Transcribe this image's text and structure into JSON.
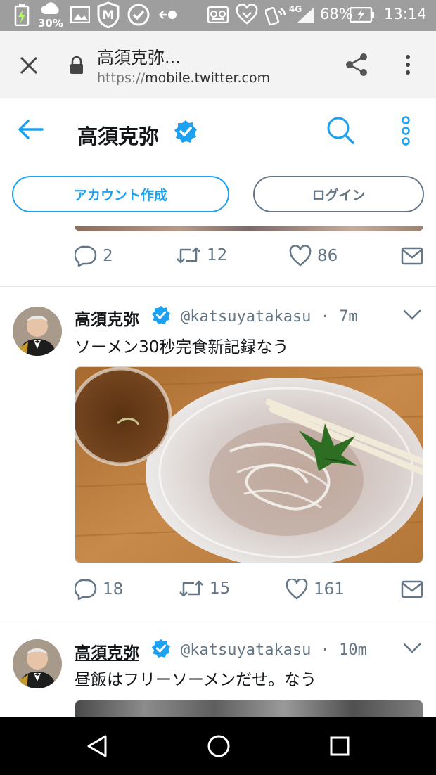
{
  "status_bar": {
    "battery_saver_percent": "30%",
    "battery_percent": "68%",
    "network": "4G",
    "time": "13:14",
    "icons": [
      "charging-icon",
      "cloud-icon",
      "image-icon",
      "mcafee-shield-icon",
      "check-circle-icon",
      "link-icon",
      "voicemail-icon",
      "heart-hand-icon",
      "nfc-icon",
      "signal-icon",
      "battery-icon"
    ]
  },
  "browser": {
    "page_title": "高須克弥...",
    "url_scheme": "https://",
    "url_host": "mobile.twitter.com",
    "icons": [
      "close-icon",
      "lock-icon",
      "share-icon",
      "more-vert-icon"
    ]
  },
  "profile_header": {
    "name": "高須克弥",
    "verified": true,
    "signup_label": "アカウント作成",
    "login_label": "ログイン",
    "accent_color": "#1da1f2"
  },
  "tweets": [
    {
      "partial": true,
      "replies": "2",
      "retweets": "12",
      "likes": "86"
    },
    {
      "name": "高須克弥",
      "handle": "@katsuyatakasu",
      "time": "· 7m",
      "text": "ソーメン30秒完食新記録なう",
      "replies": "18",
      "retweets": "15",
      "likes": "161"
    },
    {
      "name": "高須克弥",
      "handle": "@katsuyatakasu",
      "time": "· 10m",
      "text": "昼飯はフリーソーメンだせ。なう"
    }
  ],
  "nav_bar": {
    "icons": [
      "back-triangle-icon",
      "home-circle-icon",
      "recents-square-icon"
    ]
  }
}
